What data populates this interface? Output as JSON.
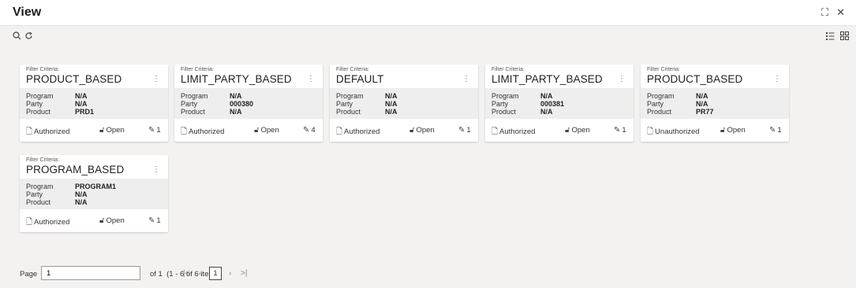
{
  "window": {
    "title": "View"
  },
  "toolbar": {
    "search_icon": "search-icon",
    "refresh_icon": "refresh-icon",
    "list_view_icon": "list-view-icon",
    "grid_view_icon": "grid-view-icon"
  },
  "cards": [
    {
      "label": "Filter Criteria:",
      "name": "PRODUCT_BASED",
      "program_k": "Program",
      "program": "N/A",
      "party_k": "Party",
      "party": "N/A",
      "product_k": "Product",
      "product": "PRD1",
      "status": "Authorized",
      "lock": "Open",
      "count": "1"
    },
    {
      "label": "Filter Criteria:",
      "name": "LIMIT_PARTY_BASED",
      "program_k": "Program",
      "program": "N/A",
      "party_k": "Party",
      "party": "000380",
      "product_k": "Product",
      "product": "N/A",
      "status": "Authorized",
      "lock": "Open",
      "count": "4"
    },
    {
      "label": "Filter Criteria:",
      "name": "DEFAULT",
      "program_k": "Program",
      "program": "N/A",
      "party_k": "Party",
      "party": "N/A",
      "product_k": "Product",
      "product": "N/A",
      "status": "Authorized",
      "lock": "Open",
      "count": "1"
    },
    {
      "label": "Filter Criteria:",
      "name": "LIMIT_PARTY_BASED",
      "program_k": "Program",
      "program": "N/A",
      "party_k": "Party",
      "party": "000381",
      "product_k": "Product",
      "product": "N/A",
      "status": "Authorized",
      "lock": "Open",
      "count": "1"
    },
    {
      "label": "Filter Criteria:",
      "name": "PRODUCT_BASED",
      "program_k": "Program",
      "program": "N/A",
      "party_k": "Party",
      "party": "N/A",
      "product_k": "Product",
      "product": "PR77",
      "status": "Unauthorized",
      "lock": "Open",
      "count": "1"
    },
    {
      "label": "Filter Criteria:",
      "name": "PROGRAM_BASED",
      "program_k": "Program",
      "program": "PROGRAM1",
      "party_k": "Party",
      "party": "N/A",
      "product_k": "Product",
      "product": "N/A",
      "status": "Authorized",
      "lock": "Open",
      "count": "1"
    }
  ],
  "pager": {
    "page_label": "Page",
    "page_value": "1",
    "of_text": "of 1",
    "items_text": "(1 - 6 of 6 items)",
    "first": "|<",
    "prev": "‹",
    "current": "1",
    "next": "›",
    "last": ">|"
  }
}
